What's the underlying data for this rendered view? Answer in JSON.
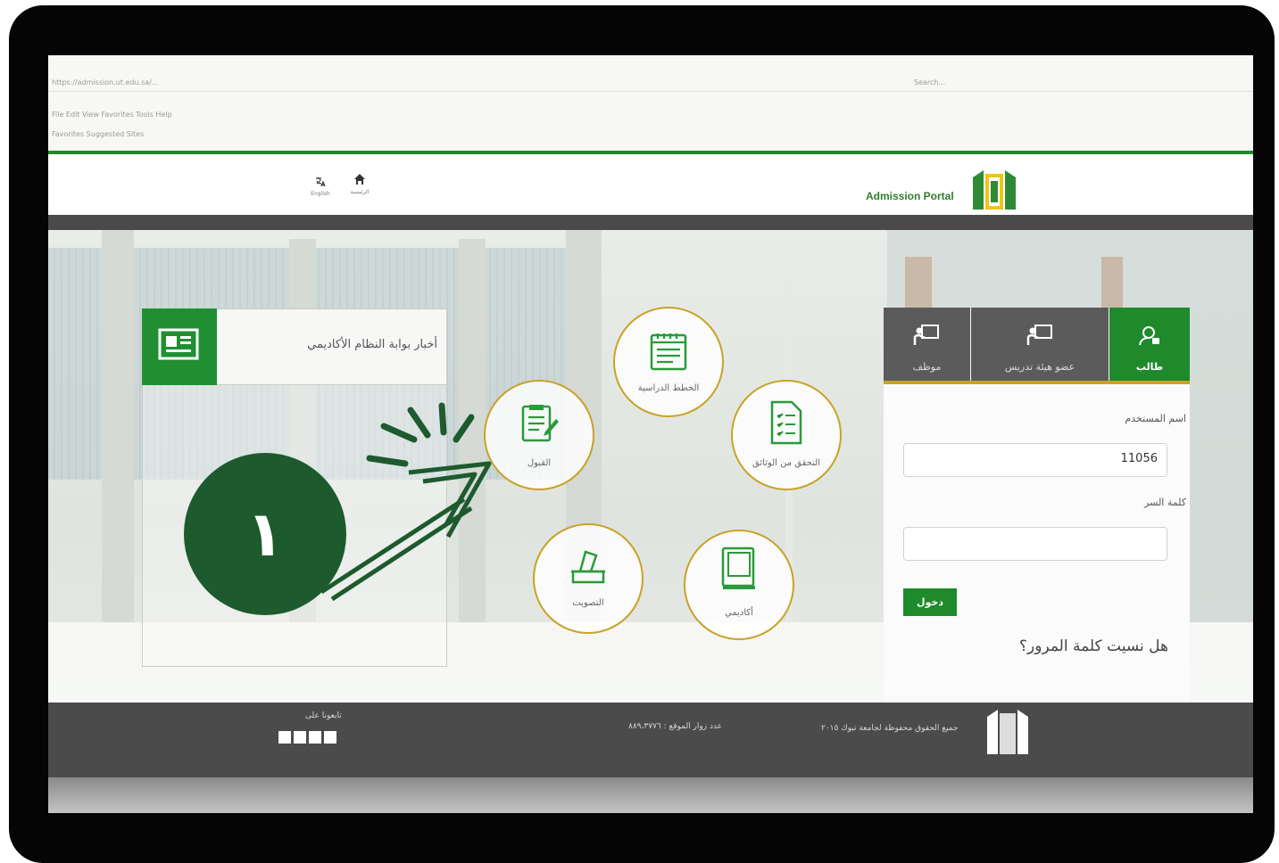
{
  "browser": {
    "address": "https://admission.ut.edu.sa/...",
    "search_placeholder": "Search...",
    "menu_text": "File   Edit   View   Favorites   Tools   Help",
    "favorites_text": "Favorites    Suggested Sites"
  },
  "header": {
    "logo_text": "Admission Portal",
    "nav": [
      {
        "label": "English",
        "icon": "translate-icon"
      },
      {
        "label": "الرئيسية",
        "icon": "home-icon"
      }
    ]
  },
  "news": {
    "title": "أخبار بوابة النظام الأكاديمي",
    "icon": "newspaper-icon"
  },
  "services": [
    {
      "label": "الخطط الدراسية",
      "icon": "study-plan-icon"
    },
    {
      "label": "القبول",
      "icon": "admission-form-icon"
    },
    {
      "label": "التحقق من الوثائق",
      "icon": "document-check-icon"
    },
    {
      "label": "التصويت",
      "icon": "ballot-box-icon"
    },
    {
      "label": "أكاديمي",
      "icon": "academic-book-icon"
    }
  ],
  "login": {
    "tabs": [
      {
        "label": "طالب",
        "icon": "student-icon",
        "active": true
      },
      {
        "label": "عضو هيئة تدريس",
        "icon": "teacher-icon",
        "active": false
      },
      {
        "label": "موظف",
        "icon": "employee-icon",
        "active": false
      }
    ],
    "username_label": "اسم المستخدم",
    "username_value": "11056",
    "password_label": "كلمة السر",
    "password_value": "",
    "submit_label": "دخول",
    "forgot_label": "هل نسيت كلمة المرور؟"
  },
  "footer": {
    "follow_label": "تابعونا على",
    "social_icons": [
      "twitter-icon",
      "youtube-icon",
      "google-plus-icon",
      "facebook-icon"
    ],
    "visitors_text": "عدد زوار الموقع : ٨٨٩،٣٧٧٦",
    "copyright_text": "جميع الحقوق محفوظة لجامعة تبوك ٢٠١٥"
  },
  "annotation": {
    "step_number": "١"
  },
  "colors": {
    "brand_green": "#1e8a2c",
    "gold": "#c9a227",
    "dark_gray": "#4b4b4b",
    "annotation_green": "#1d5a2e"
  }
}
